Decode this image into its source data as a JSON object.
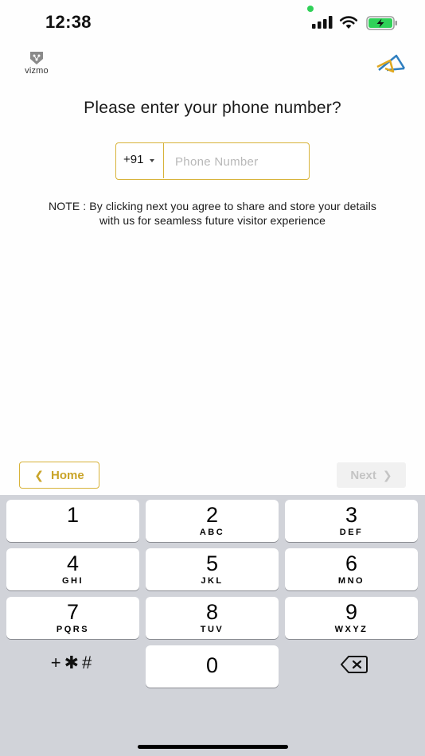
{
  "status_bar": {
    "time": "12:38",
    "icons": [
      "signal-icon",
      "wifi-icon",
      "battery-charging-icon"
    ]
  },
  "header": {
    "left_logo_text": "vizmo",
    "left_logo_icon": "vizmo-shield-icon",
    "right_logo_icon": "triangle-logo-icon"
  },
  "title": "Please enter your phone number?",
  "phone": {
    "country_code": "+91",
    "value": "",
    "placeholder": "Phone Number"
  },
  "note_line1": "NOTE : By clicking next you agree to share and store your details",
  "note_line2": "with us for seamless future visitor experience",
  "nav": {
    "home_label": "Home",
    "next_label": "Next",
    "next_enabled": false
  },
  "keypad": {
    "keys": [
      {
        "digit": "1",
        "letters": ""
      },
      {
        "digit": "2",
        "letters": "ABC"
      },
      {
        "digit": "3",
        "letters": "DEF"
      },
      {
        "digit": "4",
        "letters": "GHI"
      },
      {
        "digit": "5",
        "letters": "JKL"
      },
      {
        "digit": "6",
        "letters": "MNO"
      },
      {
        "digit": "7",
        "letters": "PQRS"
      },
      {
        "digit": "8",
        "letters": "TUV"
      },
      {
        "digit": "9",
        "letters": "WXYZ"
      }
    ],
    "zero": "0",
    "symbols": "+✱#",
    "backspace_icon": "backspace-icon"
  },
  "colors": {
    "accent": "#d8b33a",
    "keyboard_bg": "#d1d3d9",
    "battery_green": "#30d158"
  }
}
